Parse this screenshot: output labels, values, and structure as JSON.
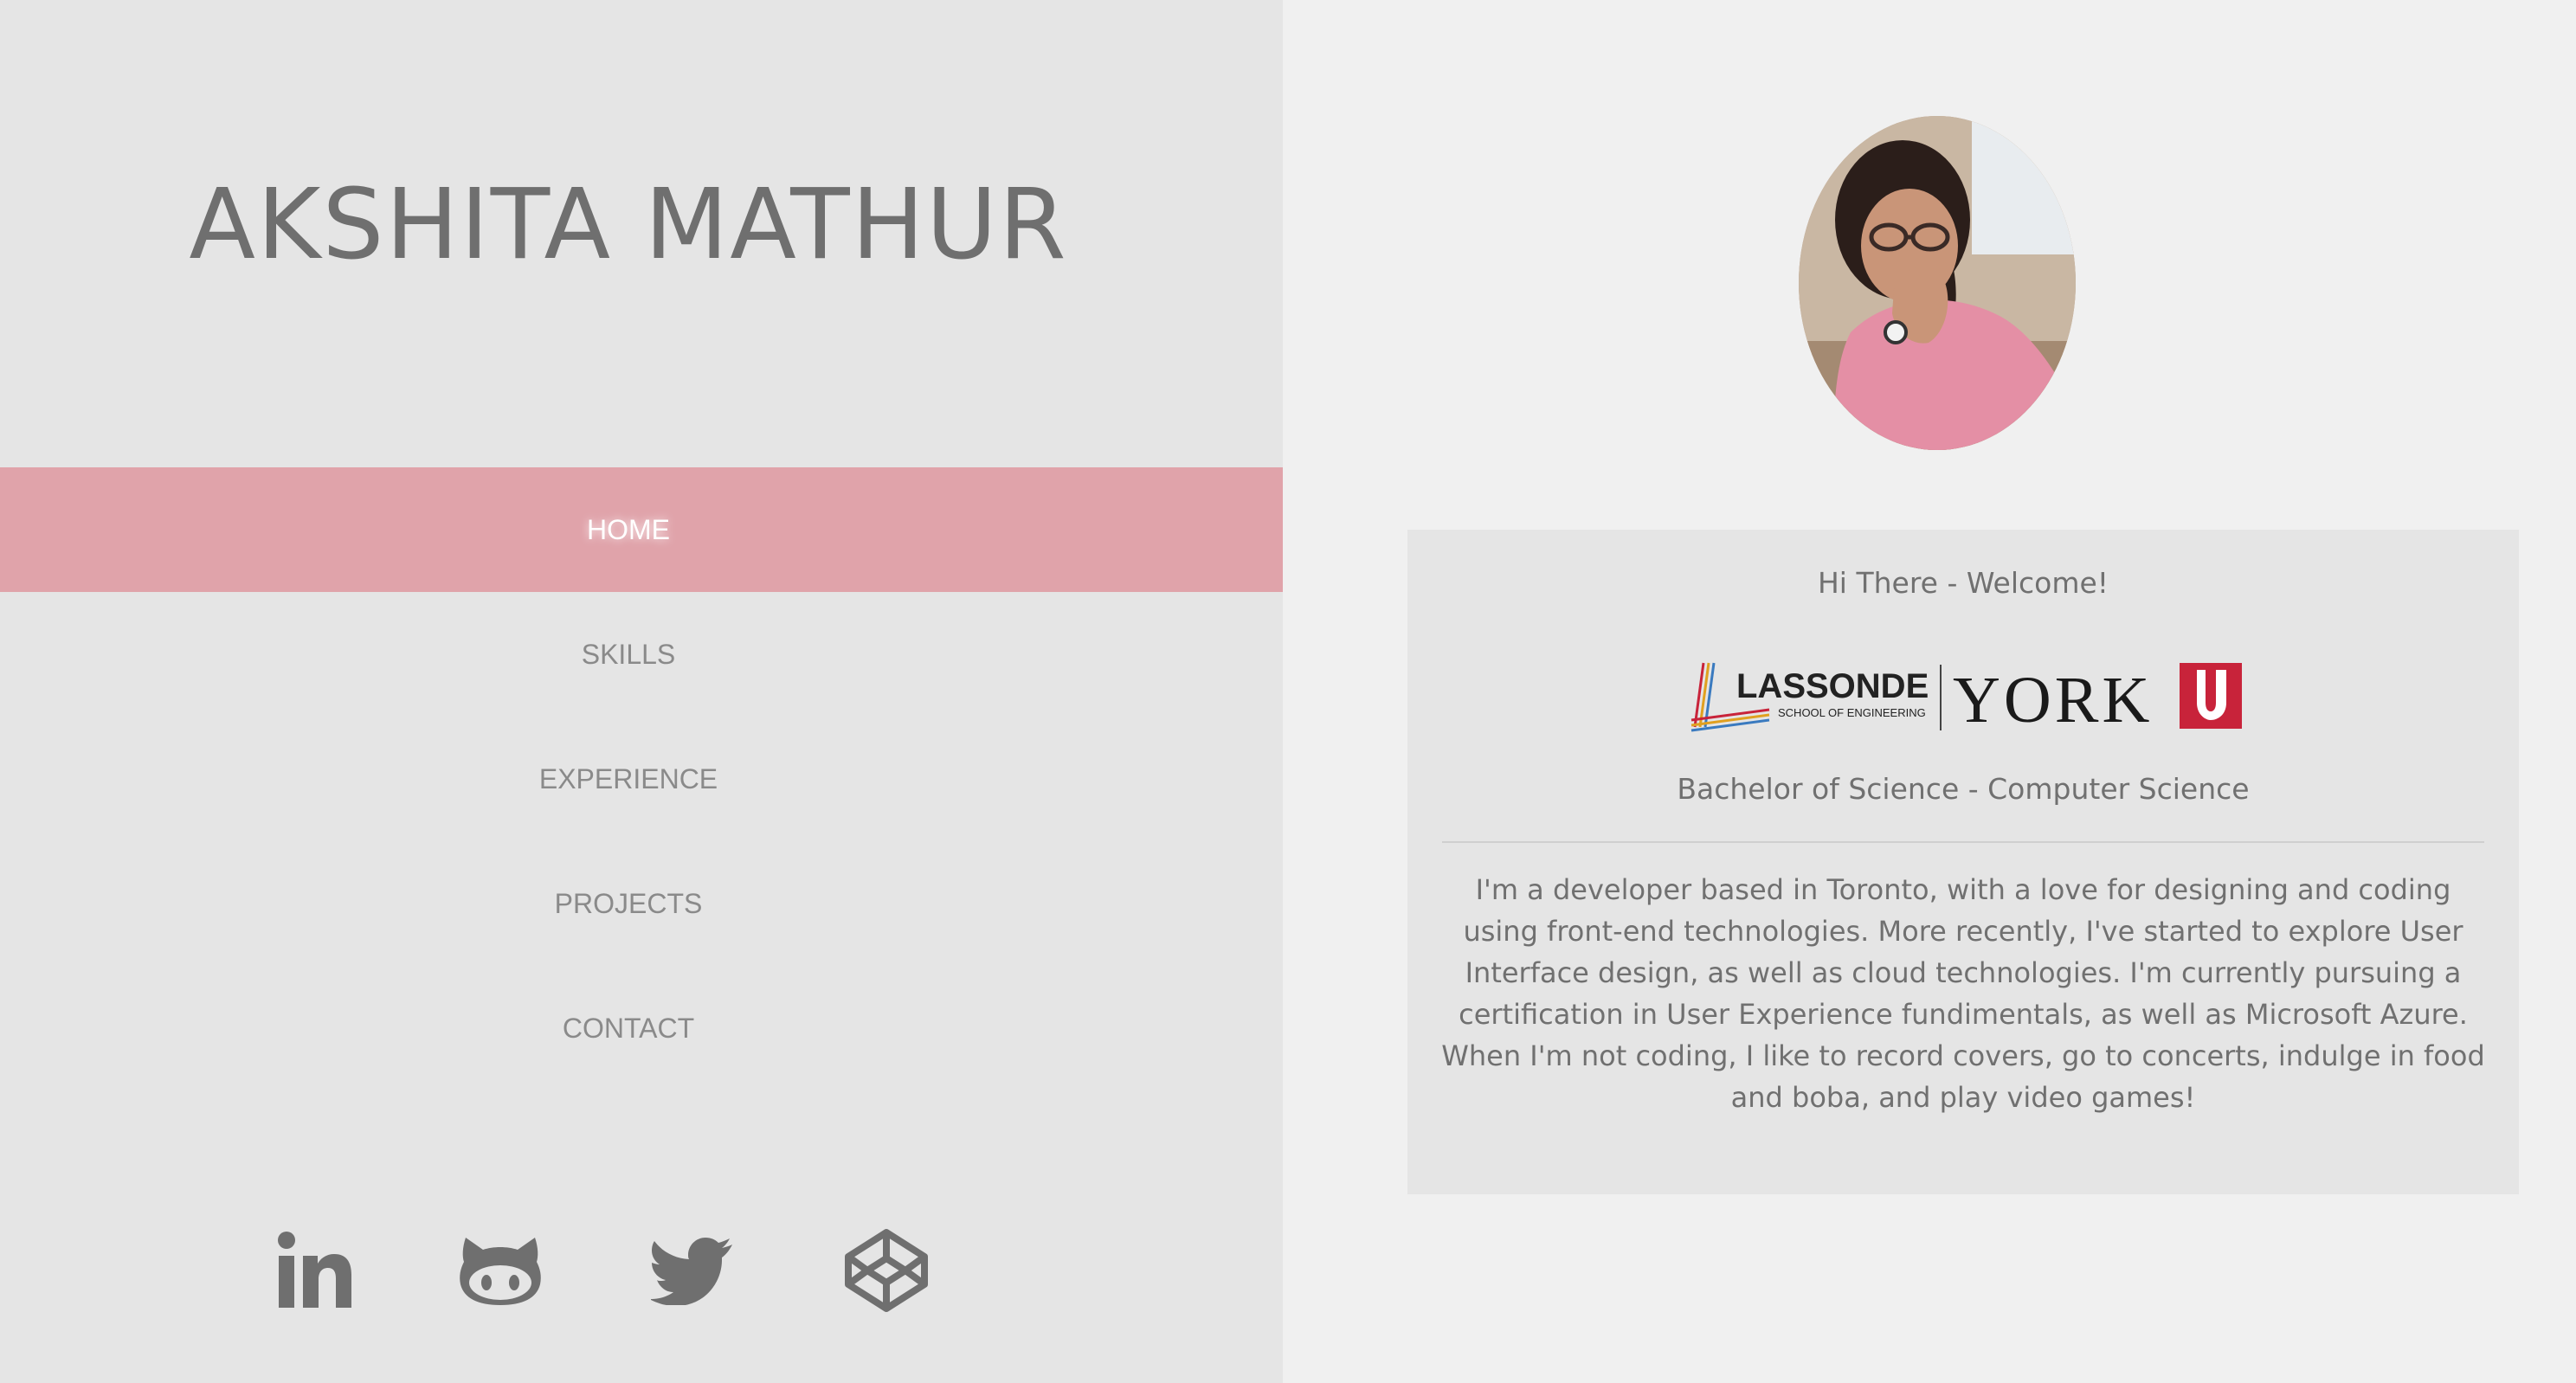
{
  "header": {
    "name": "AKSHITA MATHUR"
  },
  "nav": {
    "items": [
      {
        "label": "HOME",
        "active": true
      },
      {
        "label": "SKILLS",
        "active": false
      },
      {
        "label": "EXPERIENCE",
        "active": false
      },
      {
        "label": "PROJECTS",
        "active": false
      },
      {
        "label": "CONTACT",
        "active": false
      }
    ]
  },
  "socials": [
    {
      "icon": "linkedin-icon"
    },
    {
      "icon": "github-icon"
    },
    {
      "icon": "twitter-icon"
    },
    {
      "icon": "codepen-icon"
    }
  ],
  "profile": {
    "photo_alt": "profile photo"
  },
  "card": {
    "welcome": "Hi There - Welcome!",
    "logo": {
      "lassonde": "LASSONDE",
      "school": "SCHOOL OF ENGINEERING",
      "york": "YORK",
      "u": "U"
    },
    "degree": "Bachelor of Science - Computer Science",
    "about": "I'm a developer based in Toronto, with a love for designing and coding using front-end technologies. More recently, I've started to explore User Interface design, as well as cloud technologies. I'm currently pursuing a certification in User Experience fundimentals, as well as Microsoft Azure. When I'm not coding, I like to record covers, go to concerts, indulge in food and boba, and play video games!"
  },
  "colors": {
    "left_panel": "#e5e5e5",
    "right_bg": "#f0f0f0",
    "accent": "#e0a3aa",
    "text": "#707070",
    "york_red": "#c8233a"
  }
}
